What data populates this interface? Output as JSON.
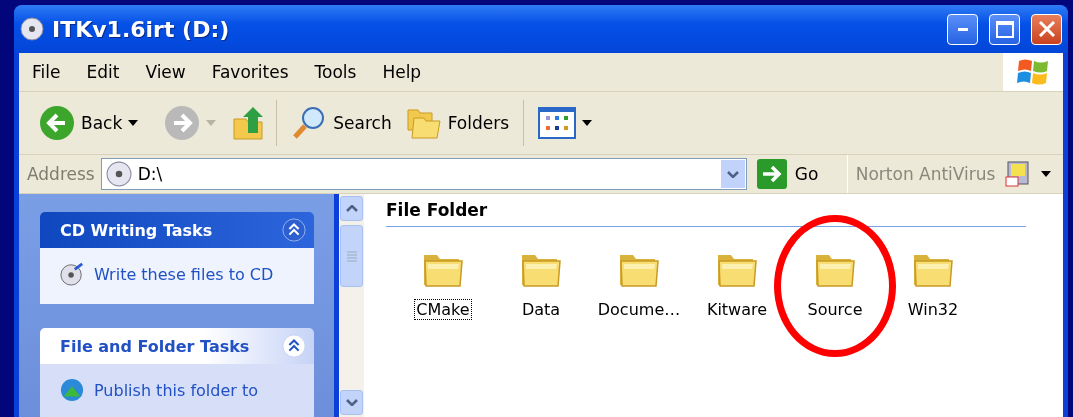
{
  "window": {
    "title": "ITKv1.6irt (D:)"
  },
  "menu": [
    "File",
    "Edit",
    "View",
    "Favorites",
    "Tools",
    "Help"
  ],
  "toolbar": {
    "back": "Back",
    "search": "Search",
    "folders": "Folders"
  },
  "address": {
    "label": "Address",
    "value": "D:\\",
    "go": "Go",
    "norton": "Norton AntiVirus"
  },
  "task_panels": [
    {
      "title": "CD Writing Tasks",
      "kind": "special",
      "expanded": true,
      "items": [
        {
          "label": "Write these files to CD"
        }
      ]
    },
    {
      "title": "File and Folder Tasks",
      "kind": "normal",
      "expanded": true,
      "items": [
        {
          "label": "Publish this folder to"
        }
      ]
    }
  ],
  "group": "File Folder",
  "folders": [
    {
      "name": "CMake",
      "focused": true,
      "circled": false
    },
    {
      "name": "Data",
      "focused": false,
      "circled": false
    },
    {
      "name": "Docume…",
      "focused": false,
      "circled": false
    },
    {
      "name": "Kitware",
      "focused": false,
      "circled": false
    },
    {
      "name": "Source",
      "focused": false,
      "circled": true
    },
    {
      "name": "Win32",
      "focused": false,
      "circled": false
    }
  ]
}
